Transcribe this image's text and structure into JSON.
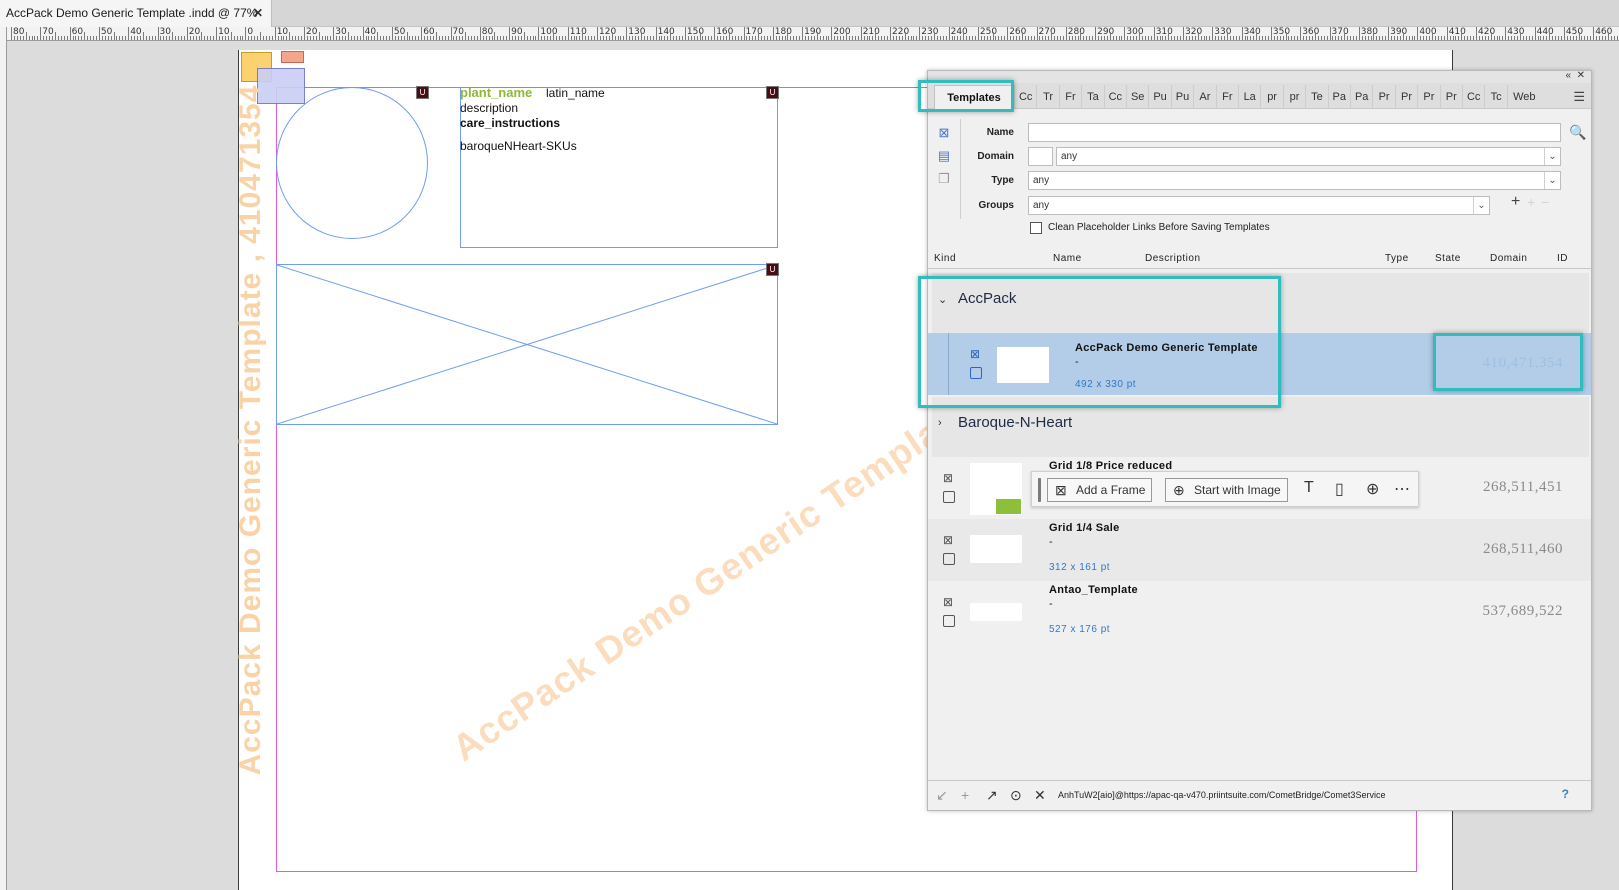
{
  "document": {
    "tab_title": "AccPack Demo Generic Template .indd @ 77%",
    "close_glyph": "✕",
    "ruler_labels": [
      "80",
      "70",
      "60",
      "50",
      "40",
      "30",
      "20",
      "10",
      "0",
      "10",
      "20",
      "30",
      "40",
      "50",
      "60",
      "70",
      "80",
      "90",
      "100",
      "110",
      "120",
      "130",
      "140",
      "150",
      "160",
      "170",
      "180",
      "190",
      "200",
      "210",
      "220",
      "230",
      "240",
      "250",
      "260",
      "270",
      "280",
      "290",
      "300",
      "310",
      "320",
      "330",
      "340",
      "350",
      "360",
      "370",
      "380",
      "390",
      "400",
      "410",
      "420",
      "430",
      "440",
      "450",
      "460",
      "470"
    ]
  },
  "canvas": {
    "watermark_vertical": "AccPack Demo Generic Template , 410471354",
    "watermark_diagonal": "AccPack Demo Generic Template",
    "placeholder_plant_name": "plant_name",
    "placeholder_latin_name": "latin_name",
    "placeholder_description": "description",
    "placeholder_care": "care_instructions",
    "placeholder_skus": "baroqueNHeart-SKUs",
    "anchor_glyph": "U"
  },
  "panel": {
    "tabs": [
      "Templates",
      "Cc",
      "Tr",
      "Fr",
      "Ta",
      "Cc",
      "Se",
      "Pu",
      "Pu",
      "Ar",
      "Fr",
      "La",
      "pr",
      "pr",
      "Te",
      "Pa",
      "Pa",
      "Pr",
      "Pr",
      "Pr",
      "Pr",
      "Cc",
      "Tc",
      "Web"
    ],
    "form": {
      "name_label": "Name",
      "name_value": "",
      "domain_label": "Domain",
      "domain_value": "any",
      "type_label": "Type",
      "type_value": "any",
      "groups_label": "Groups",
      "groups_value": "any",
      "clean_label": "Clean Placeholder Links Before Saving Templates"
    },
    "columns": {
      "kind": "Kind",
      "name": "Name",
      "description": "Description",
      "type": "Type",
      "state": "State",
      "domain": "Domain",
      "id": "ID"
    },
    "groups": [
      {
        "title": "AccPack",
        "expanded": true
      },
      {
        "title": "Baroque-N-Heart",
        "expanded": false
      }
    ],
    "templates": [
      {
        "name": "AccPack Demo Generic Template",
        "desc": "-",
        "size": "492 x 330 pt",
        "id": "410,471,354",
        "selected": true
      },
      {
        "name": "Grid 1/8 Price reduced",
        "desc": "-",
        "size": "",
        "id": "268,511,451",
        "selected": false
      },
      {
        "name": "Grid 1/4 Sale",
        "desc": "-",
        "size": "312 x 161 pt",
        "id": "268,511,460",
        "selected": false
      },
      {
        "name": "Antao_Template",
        "desc": "-",
        "size": "527 x 176 pt",
        "id": "537,689,522",
        "selected": false
      }
    ],
    "hover_toolbar": {
      "add_frame": "Add a Frame",
      "start_image": "Start with Image"
    },
    "status": {
      "connection": "AnhTuW2[aio]@https://apac-qa-v470.priintsuite.com/CometBridge/Comet3Service",
      "help": "?"
    }
  },
  "colors": {
    "highlight": "#2fbdbd",
    "selection": "#b3cde9",
    "guide_magenta": "#e05ce0",
    "frame_blue": "#6d9ef0",
    "watermark": "#f9d3a6"
  }
}
